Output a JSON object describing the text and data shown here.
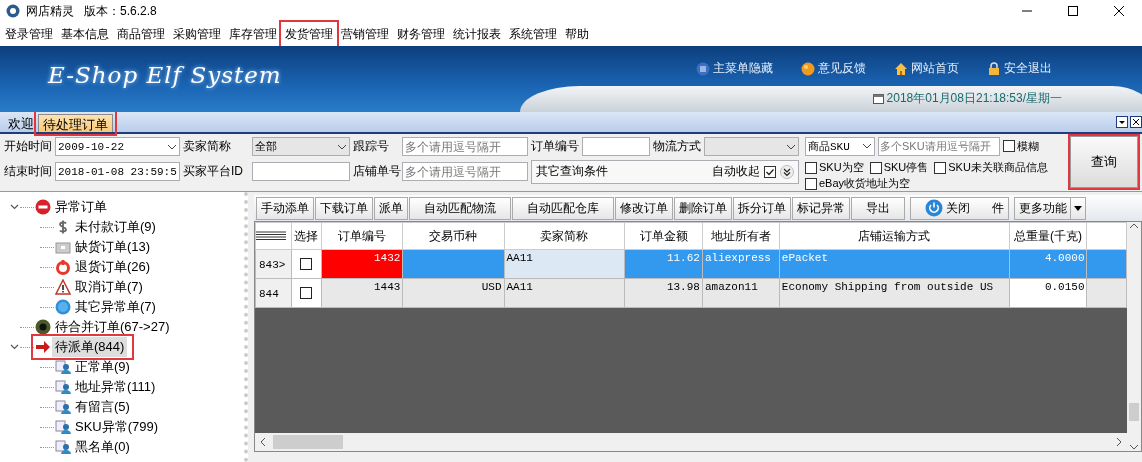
{
  "window": {
    "app_name": "网店精灵",
    "version": "版本：5.6.2.8"
  },
  "menu": [
    {
      "label": "登录管理",
      "annotated": false
    },
    {
      "label": "基本信息",
      "annotated": false
    },
    {
      "label": "商品管理",
      "annotated": false
    },
    {
      "label": "采购管理",
      "annotated": false
    },
    {
      "label": "库存管理",
      "annotated": false
    },
    {
      "label": "发货管理",
      "annotated": true
    },
    {
      "label": "营销管理",
      "annotated": false
    },
    {
      "label": "财务管理",
      "annotated": false
    },
    {
      "label": "统计报表",
      "annotated": false
    },
    {
      "label": "系统管理",
      "annotated": false
    },
    {
      "label": "帮助",
      "annotated": false
    }
  ],
  "banner": {
    "logo": "E-Shop Elf System",
    "links": [
      {
        "kind": "list",
        "label": "主菜单隐藏"
      },
      {
        "kind": "ball",
        "label": "意见反馈"
      },
      {
        "kind": "home",
        "label": "网站首页"
      },
      {
        "kind": "lock",
        "label": "安全退出"
      }
    ],
    "datetime": "2018年01月08日21:18:53/星期一"
  },
  "tabs": [
    {
      "label": "欢迎",
      "selected": false,
      "annotated": false
    },
    {
      "label": "待处理订单",
      "selected": true,
      "annotated": true
    }
  ],
  "filters": {
    "start_label": "开始时间",
    "start_value": "2009-10-22",
    "end_label": "结束时间",
    "end_value": "2018-01-08 23:59:5",
    "seller_label": "卖家简称",
    "seller_value": "全部",
    "buyer_id_label": "买家平台ID",
    "tracking_label": "跟踪号",
    "tracking_placeholder": "多个请用逗号隔开",
    "shop_no_label": "店铺单号",
    "shop_no_placeholder": "多个请用逗号隔开",
    "order_no_label": "订单编号",
    "logistics_label": "物流方式",
    "other_conditions": "其它查询条件",
    "auto_collapse_label": "自动收起",
    "auto_collapse": true,
    "sku_select": "商品SKU",
    "sku_placeholder": "多个SKU请用逗号隔开",
    "fuzzy_label": "模糊",
    "fuzzy": false,
    "checks": [
      {
        "label": "SKU为空",
        "checked": false
      },
      {
        "label": "SKU停售",
        "checked": false
      },
      {
        "label": "SKU未关联商品信息",
        "checked": false
      },
      {
        "label": "eBay收货地址为空",
        "checked": false
      }
    ],
    "query_button": "查询",
    "query_annotated": true
  },
  "tree": [
    {
      "label": "异常订单",
      "kind": "stop",
      "expanded": true,
      "selected": false,
      "annotated": false,
      "children": [
        {
          "label": "未付款订单(9)",
          "kind": "dollar",
          "selected": false,
          "annotated": false
        },
        {
          "label": "缺货订单(13)",
          "kind": "box",
          "selected": false,
          "annotated": false
        },
        {
          "label": "退货订单(26)",
          "kind": "return",
          "selected": false,
          "annotated": false
        },
        {
          "label": "取消订单(7)",
          "kind": "warning",
          "selected": false,
          "annotated": false
        },
        {
          "label": "其它异常单(7)",
          "kind": "help",
          "selected": false,
          "annotated": false
        }
      ]
    },
    {
      "label": "待合并订单(67->27)",
      "kind": "gear",
      "selected": false,
      "annotated": false
    },
    {
      "label": "待派单(844)",
      "kind": "arrow",
      "expanded": true,
      "selected": true,
      "annotated": true,
      "children": [
        {
          "label": "正常单(9)",
          "kind": "user",
          "selected": false,
          "annotated": false
        },
        {
          "label": "地址异常(111)",
          "kind": "user",
          "selected": false,
          "annotated": false
        },
        {
          "label": "有留言(5)",
          "kind": "user",
          "selected": false,
          "annotated": false
        },
        {
          "label": "SKU异常(799)",
          "kind": "user",
          "selected": false,
          "annotated": false
        },
        {
          "label": "黑名单(0)",
          "kind": "user",
          "selected": false,
          "annotated": false
        }
      ]
    }
  ],
  "toolbar": [
    {
      "label": "手动添单",
      "kind": "plain"
    },
    {
      "label": "下载订单",
      "kind": "plain"
    },
    {
      "label": "派单",
      "kind": "plain"
    },
    {
      "label": "自动匹配物流",
      "kind": "plain"
    },
    {
      "label": "自动匹配仓库",
      "kind": "plain"
    },
    {
      "label": "修改订单",
      "kind": "plain"
    },
    {
      "label": "删除订单",
      "kind": "plain"
    },
    {
      "label": "拆分订单",
      "kind": "plain"
    },
    {
      "label": "标记异常",
      "kind": "plain"
    },
    {
      "label": "导出",
      "kind": "plain"
    },
    {
      "label": "关闭",
      "kind": "power"
    },
    {
      "label": "件",
      "kind": "hidden-left"
    },
    {
      "label": "更多功能",
      "kind": "dropdown"
    }
  ],
  "table": {
    "select_label": "选择",
    "columns": [
      "订单编号",
      "交易币种",
      "卖家简称",
      "订单金额",
      "地址所有者",
      "店铺运输方式",
      "总重量(千克)"
    ],
    "rows": [
      {
        "row_label": "843>",
        "checked": false,
        "selected": true,
        "cells": [
          {
            "text": "1432",
            "color": "#ff0000"
          },
          null,
          {
            "text": "AA11",
            "color": "#dde8f5"
          },
          {
            "text": "11.62"
          },
          {
            "text": "aliexpress"
          },
          {
            "text": "ePacket"
          },
          {
            "text": "4.0000"
          }
        ]
      },
      {
        "row_label": "844",
        "checked": false,
        "selected": false,
        "cells": [
          {
            "text": "1443"
          },
          {
            "text": "USD"
          },
          {
            "text": "AA11"
          },
          {
            "text": "13.98"
          },
          {
            "text": "amazon11"
          },
          {
            "text": "Economy Shipping from outside US"
          },
          {
            "text": "0.0150",
            "color": "#ffffff"
          }
        ]
      }
    ]
  }
}
